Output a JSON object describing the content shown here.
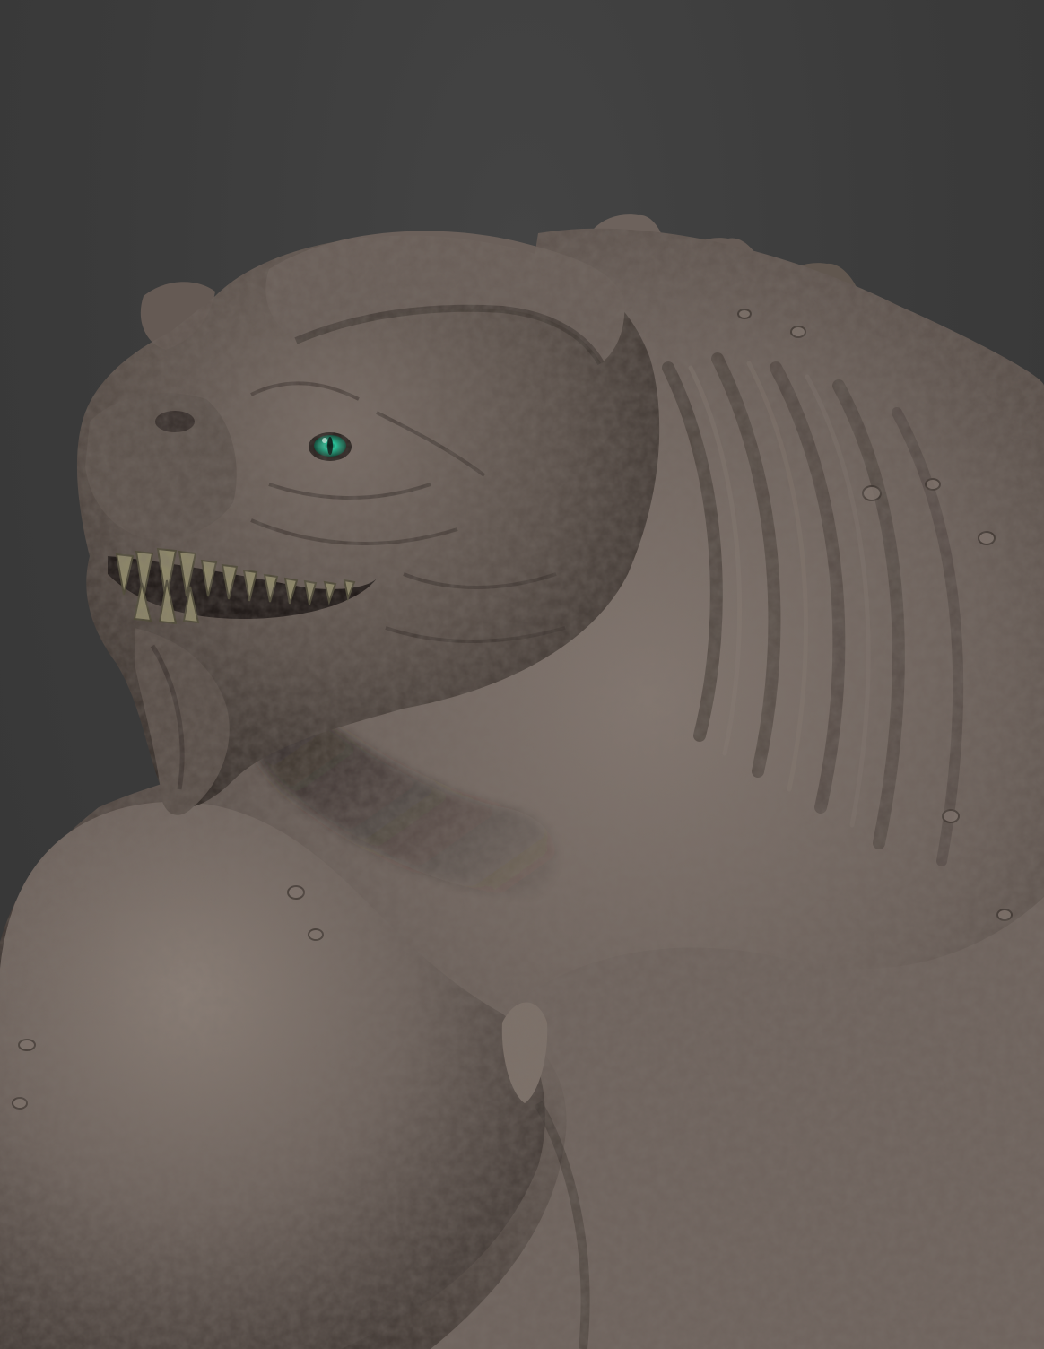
{
  "scene": {
    "subject": "creature-sculpt",
    "colors": {
      "background": "#3b3b3b",
      "skin_light": "#7c7069",
      "skin_mid": "#5f554f",
      "skin_dark": "#3a322e",
      "teeth": "#8a8466",
      "eye": "#1fd0a0"
    }
  }
}
